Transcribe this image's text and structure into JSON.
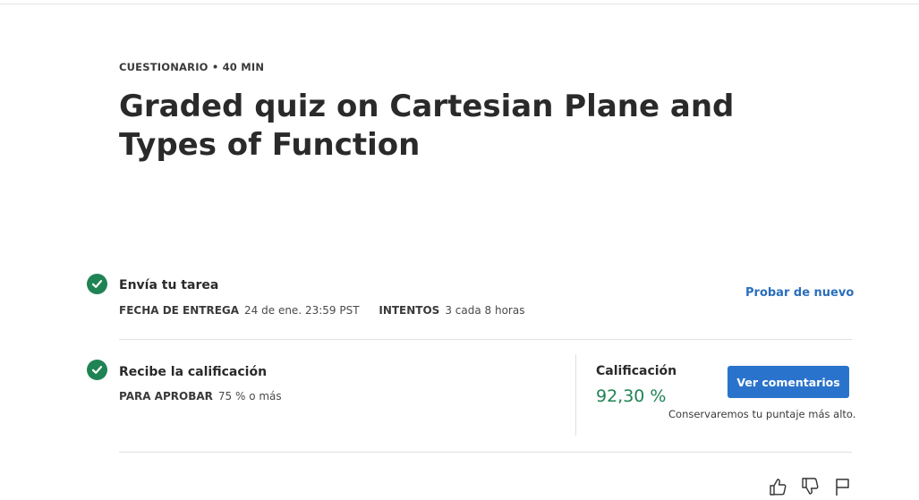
{
  "header": {
    "eyebrow": "CUESTIONARIO • 40 MIN",
    "title": "Graded quiz on Cartesian Plane and Types of Function"
  },
  "steps": [
    {
      "title": "Envía tu tarea",
      "status_icon": "check-circle-icon",
      "meta": [
        {
          "label": "FECHA DE ENTREGA",
          "value": "24 de ene. 23:59 PST"
        },
        {
          "label": "INTENTOS",
          "value": "3 cada 8 horas"
        }
      ],
      "action_link": "Probar de nuevo"
    },
    {
      "title": "Recibe la calificación",
      "status_icon": "check-circle-icon",
      "meta": [
        {
          "label": "PARA APROBAR",
          "value": "75 % o más"
        }
      ]
    }
  ],
  "grade": {
    "label": "Calificación",
    "value": "92,30 %",
    "button": "Ver comentarios",
    "note": "Conservaremos tu puntaje más alto."
  },
  "footer_icons": [
    "thumbs-up-icon",
    "thumbs-down-icon",
    "flag-icon"
  ],
  "colors": {
    "success": "#1f8354",
    "link": "#2a6ebb",
    "button": "#2a73cc"
  }
}
